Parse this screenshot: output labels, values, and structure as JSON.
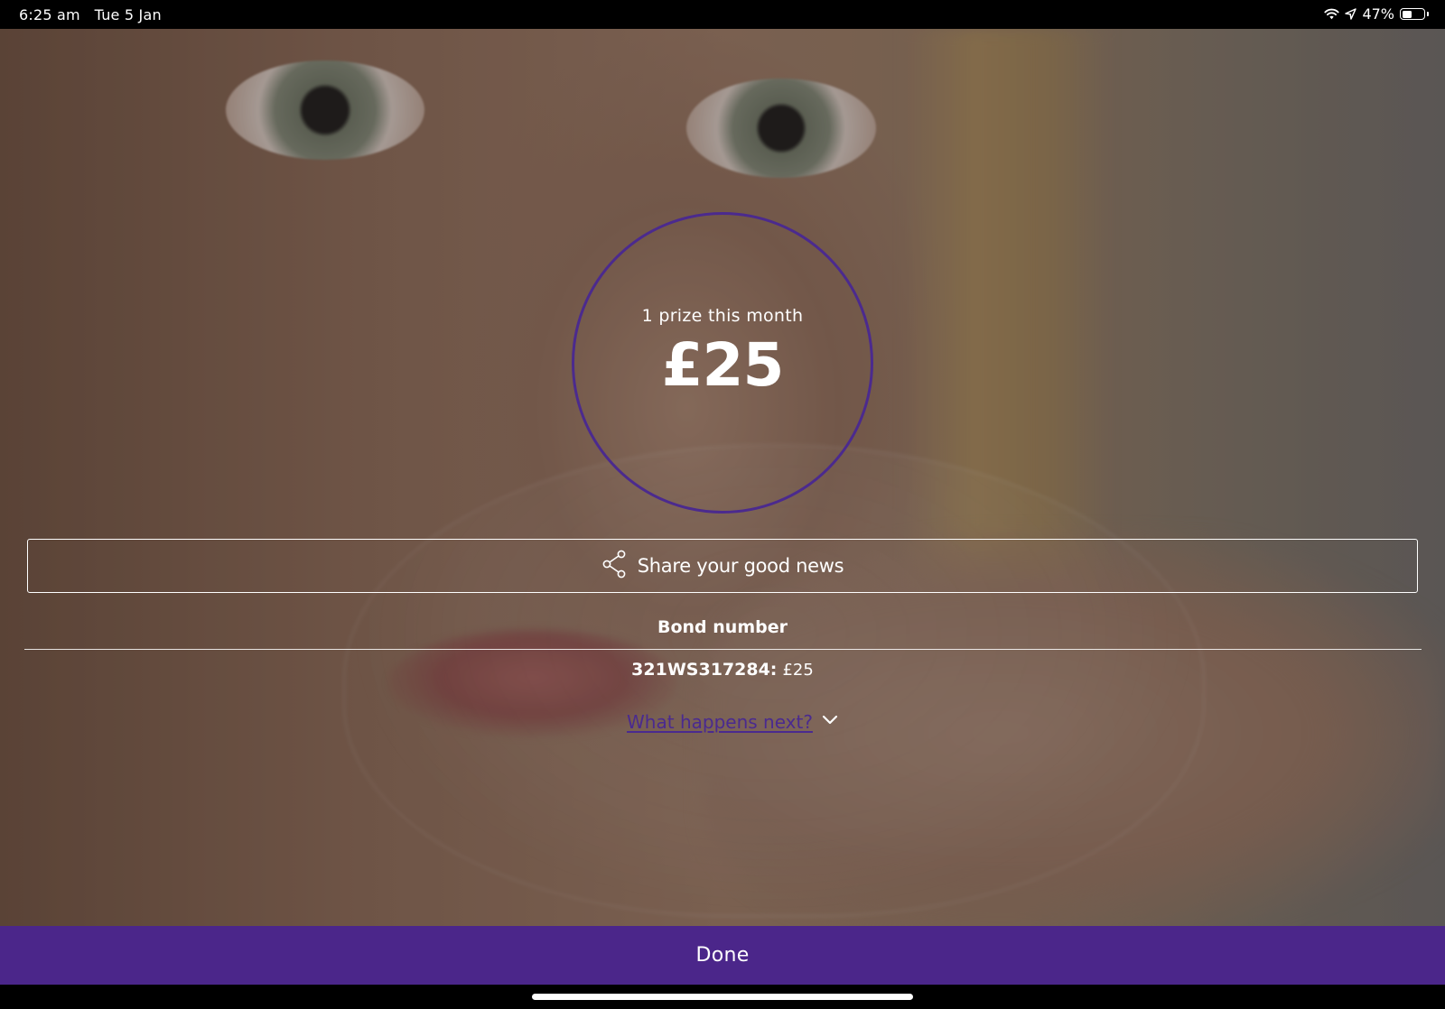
{
  "status_bar": {
    "time_date": "6:25 am   Tue 5 Jan",
    "battery_percent": "47%",
    "battery_level": 0.47,
    "icons": [
      "wifi-icon",
      "location-arrow-icon",
      "battery-icon"
    ]
  },
  "prize": {
    "caption": "1 prize this month",
    "amount": "£25"
  },
  "share": {
    "label": "Share your good news",
    "icon": "share-icon"
  },
  "bond": {
    "heading": "Bond number",
    "number": "321WS317284:",
    "value": "£25"
  },
  "next_link": {
    "label": "What happens next?",
    "icon": "chevron-down-icon"
  },
  "done": {
    "label": "Done"
  },
  "colors": {
    "accent": "#4b268a",
    "circle": "#4b2a8e",
    "link": "#4a2a8f"
  }
}
